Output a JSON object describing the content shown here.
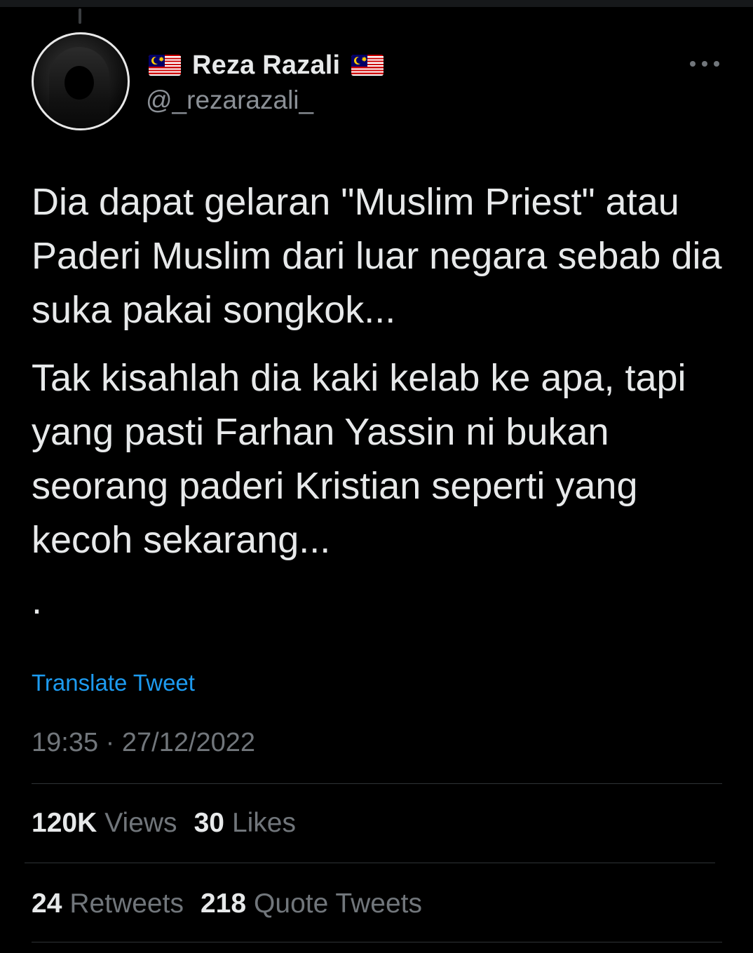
{
  "tweet": {
    "display_name": "Reza Razali",
    "handle": "@_rezarazali_",
    "name_flag_icon": "malaysia-flag-icon",
    "more_icon": "more-options-icon",
    "paragraphs": [
      "Dia dapat gelaran \"Muslim Priest\" atau Paderi Muslim dari luar negara sebab dia suka pakai songkok...",
      "Tak kisahlah dia kaki kelab ke apa, tapi yang pasti Farhan Yassin ni bukan seorang paderi Kristian seperti yang kecoh sekarang...",
      "."
    ],
    "translate_label": "Translate Tweet",
    "timestamp": "19:35 · 27/12/2022"
  },
  "stats": {
    "views_count": "120K",
    "views_label": "Views",
    "likes_count": "30",
    "likes_label": "Likes",
    "retweets_count": "24",
    "retweets_label": "Retweets",
    "quotes_count": "218",
    "quotes_label": "Quote Tweets"
  },
  "colors": {
    "background": "#000000",
    "primary_text": "#e7e9ea",
    "secondary_text": "#71767b",
    "link": "#1d9bf0",
    "divider": "#2f3336"
  }
}
